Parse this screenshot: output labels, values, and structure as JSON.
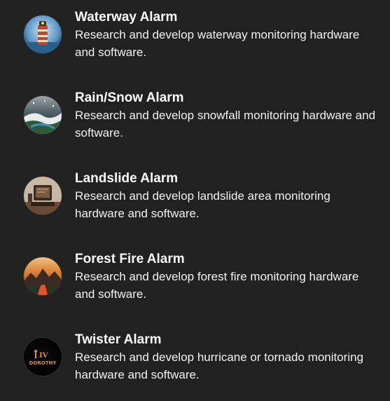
{
  "items": [
    {
      "title": "Waterway Alarm",
      "description": "Research and develop waterway monitoring hardware and software.",
      "avatar_icon": "lighthouse-icon"
    },
    {
      "title": "Rain/Snow Alarm",
      "description": "Research and develop snowfall monitoring hardware and software.",
      "avatar_icon": "snowy-landscape-icon"
    },
    {
      "title": "Landslide Alarm",
      "description": "Research and develop landslide area monitoring hardware and software.",
      "avatar_icon": "computer-terminal-icon"
    },
    {
      "title": "Forest Fire Alarm",
      "description": "Research and develop forest fire monitoring hardware and software.",
      "avatar_icon": "forest-fire-icon"
    },
    {
      "title": "Twister Alarm",
      "description": "Research and develop hurricane or tornado monitoring hardware and software.",
      "avatar_icon": "dorothy-logo-icon",
      "avatar_text": [
        "IV",
        "DOROTHY"
      ]
    }
  ],
  "colors": {
    "background": "#212121",
    "text": "#ffffff"
  }
}
